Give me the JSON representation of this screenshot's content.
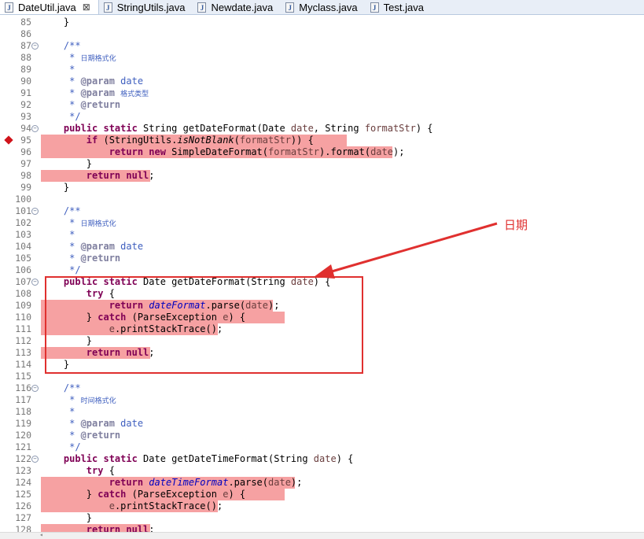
{
  "tabs": [
    {
      "label": "DateUtil.java",
      "active": true,
      "close": "⊠"
    },
    {
      "label": "StringUtils.java",
      "active": false
    },
    {
      "label": "Newdate.java",
      "active": false
    },
    {
      "label": "Myclass.java",
      "active": false
    },
    {
      "label": "Test.java",
      "active": false
    }
  ],
  "annotation": {
    "label": "日期"
  },
  "lines": [
    {
      "n": "85",
      "t": [
        [
          "",
          "    }"
        ]
      ]
    },
    {
      "n": "86",
      "t": []
    },
    {
      "n": "87",
      "fold": true,
      "t": [
        [
          "cm",
          "    /**"
        ]
      ]
    },
    {
      "n": "88",
      "t": [
        [
          "cm",
          "     * "
        ],
        [
          "cjk",
          "日期格式化"
        ]
      ]
    },
    {
      "n": "89",
      "t": [
        [
          "cm",
          "     *"
        ]
      ]
    },
    {
      "n": "90",
      "t": [
        [
          "cm",
          "     * "
        ],
        [
          "tag",
          "@param"
        ],
        [
          "cm",
          " date"
        ]
      ]
    },
    {
      "n": "91",
      "t": [
        [
          "cm",
          "     * "
        ],
        [
          "tag",
          "@param"
        ],
        [
          "cm",
          " "
        ],
        [
          "cjk",
          "格式类型"
        ]
      ]
    },
    {
      "n": "92",
      "t": [
        [
          "cm",
          "     * "
        ],
        [
          "tag",
          "@return"
        ]
      ]
    },
    {
      "n": "93",
      "t": [
        [
          "cm",
          "     */"
        ]
      ]
    },
    {
      "n": "94",
      "fold": true,
      "t": [
        [
          "kw",
          "    public static "
        ],
        [
          "",
          "String getDateFormat(Date "
        ],
        [
          "par",
          "date"
        ],
        [
          "",
          ", String "
        ],
        [
          "par",
          "formatStr"
        ],
        [
          "",
          ") {"
        ]
      ]
    },
    {
      "n": "95",
      "bp": true,
      "hl": 389,
      "t": [
        [
          "kw",
          "        if "
        ],
        [
          "",
          "(StringUtils."
        ],
        [
          "sm",
          "isNotBlank"
        ],
        [
          "",
          "("
        ],
        [
          "par",
          "formatStr"
        ],
        [
          "",
          ")) {"
        ]
      ]
    },
    {
      "n": "96",
      "hl": 447,
      "t": [
        [
          "kw",
          "            return new "
        ],
        [
          "",
          "SimpleDateFormat("
        ],
        [
          "par",
          "formatStr"
        ],
        [
          "",
          ").format("
        ],
        [
          "par",
          "date"
        ],
        [
          "",
          ");"
        ]
      ]
    },
    {
      "n": "97",
      "t": [
        [
          "",
          "        }"
        ]
      ]
    },
    {
      "n": "98",
      "hl": 139,
      "t": [
        [
          "kw",
          "        return null"
        ],
        [
          "",
          ";"
        ]
      ]
    },
    {
      "n": "99",
      "t": [
        [
          "",
          "    }"
        ]
      ]
    },
    {
      "n": "100",
      "t": []
    },
    {
      "n": "101",
      "fold": true,
      "t": [
        [
          "cm",
          "    /**"
        ]
      ]
    },
    {
      "n": "102",
      "t": [
        [
          "cm",
          "     * "
        ],
        [
          "cjk",
          "日期格式化"
        ]
      ]
    },
    {
      "n": "103",
      "t": [
        [
          "cm",
          "     *"
        ]
      ]
    },
    {
      "n": "104",
      "t": [
        [
          "cm",
          "     * "
        ],
        [
          "tag",
          "@param"
        ],
        [
          "cm",
          " date"
        ]
      ]
    },
    {
      "n": "105",
      "t": [
        [
          "cm",
          "     * "
        ],
        [
          "tag",
          "@return"
        ]
      ]
    },
    {
      "n": "106",
      "t": [
        [
          "cm",
          "     */"
        ]
      ]
    },
    {
      "n": "107",
      "fold": true,
      "t": [
        [
          "kw",
          "    public static "
        ],
        [
          "",
          "Date getDateFormat(String "
        ],
        [
          "par",
          "date"
        ],
        [
          "",
          ") {"
        ]
      ]
    },
    {
      "n": "108",
      "t": [
        [
          "kw",
          "        try "
        ],
        [
          "",
          "{"
        ]
      ]
    },
    {
      "n": "109",
      "hl": 295,
      "t": [
        [
          "kw",
          "            return "
        ],
        [
          "fld",
          "dateFormat"
        ],
        [
          "",
          ".parse("
        ],
        [
          "par",
          "date"
        ],
        [
          "",
          ");"
        ]
      ]
    },
    {
      "n": "110",
      "hl": 310,
      "t": [
        [
          "",
          "        } "
        ],
        [
          "kw",
          "catch "
        ],
        [
          "",
          "(ParseException "
        ],
        [
          "par",
          "e"
        ],
        [
          "",
          ") {"
        ]
      ]
    },
    {
      "n": "111",
      "hl": 225,
      "t": [
        [
          "",
          "            "
        ],
        [
          "par",
          "e"
        ],
        [
          "",
          ".printStackTrace();"
        ]
      ]
    },
    {
      "n": "112",
      "t": [
        [
          "",
          "        }"
        ]
      ]
    },
    {
      "n": "113",
      "hl": 139,
      "t": [
        [
          "kw",
          "        return null"
        ],
        [
          "",
          ";"
        ]
      ]
    },
    {
      "n": "114",
      "t": [
        [
          "",
          "    }"
        ]
      ]
    },
    {
      "n": "115",
      "t": []
    },
    {
      "n": "116",
      "fold": true,
      "t": [
        [
          "cm",
          "    /**"
        ]
      ]
    },
    {
      "n": "117",
      "t": [
        [
          "cm",
          "     * "
        ],
        [
          "cjk",
          "时间格式化"
        ]
      ]
    },
    {
      "n": "118",
      "t": [
        [
          "cm",
          "     *"
        ]
      ]
    },
    {
      "n": "119",
      "t": [
        [
          "cm",
          "     * "
        ],
        [
          "tag",
          "@param"
        ],
        [
          "cm",
          " date"
        ]
      ]
    },
    {
      "n": "120",
      "t": [
        [
          "cm",
          "     * "
        ],
        [
          "tag",
          "@return"
        ]
      ]
    },
    {
      "n": "121",
      "t": [
        [
          "cm",
          "     */"
        ]
      ]
    },
    {
      "n": "122",
      "fold": true,
      "t": [
        [
          "kw",
          "    public static "
        ],
        [
          "",
          "Date getDateTimeFormat(String "
        ],
        [
          "par",
          "date"
        ],
        [
          "",
          ") {"
        ]
      ]
    },
    {
      "n": "123",
      "t": [
        [
          "kw",
          "        try "
        ],
        [
          "",
          "{"
        ]
      ]
    },
    {
      "n": "124",
      "hl": 323,
      "t": [
        [
          "kw",
          "            return "
        ],
        [
          "fld",
          "dateTimeFormat"
        ],
        [
          "",
          ".parse("
        ],
        [
          "par",
          "date"
        ],
        [
          "",
          ");"
        ]
      ]
    },
    {
      "n": "125",
      "hl": 310,
      "t": [
        [
          "",
          "        } "
        ],
        [
          "kw",
          "catch "
        ],
        [
          "",
          "(ParseException "
        ],
        [
          "par",
          "e"
        ],
        [
          "",
          ") {"
        ]
      ]
    },
    {
      "n": "126",
      "hl": 225,
      "t": [
        [
          "",
          "            "
        ],
        [
          "par",
          "e"
        ],
        [
          "",
          ".printStackTrace();"
        ]
      ]
    },
    {
      "n": "127",
      "t": [
        [
          "",
          "        }"
        ]
      ]
    },
    {
      "n": "128",
      "hl": 139,
      "t": [
        [
          "kw",
          "        return null"
        ],
        [
          "",
          ";"
        ]
      ]
    }
  ]
}
